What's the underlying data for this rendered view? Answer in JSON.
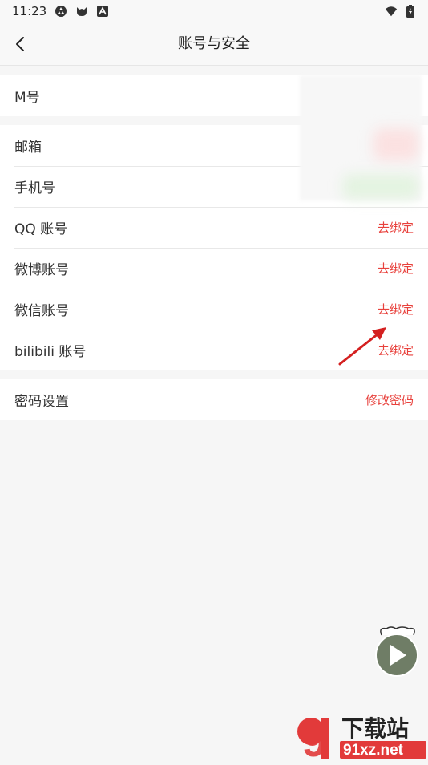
{
  "status_bar": {
    "time": "11:23"
  },
  "header": {
    "title": "账号与安全"
  },
  "groups": [
    {
      "rows": [
        {
          "label": "M号"
        }
      ]
    },
    {
      "rows": [
        {
          "label": "邮箱"
        },
        {
          "label": "手机号"
        },
        {
          "label": "QQ 账号",
          "action": "去绑定"
        },
        {
          "label": "微博账号",
          "action": "去绑定"
        },
        {
          "label": "微信账号",
          "action": "去绑定"
        },
        {
          "label": "bilibili 账号",
          "action": "去绑定"
        }
      ]
    },
    {
      "rows": [
        {
          "label": "密码设置",
          "action": "修改密码"
        }
      ]
    }
  ],
  "watermark": {
    "brand": "9",
    "text": "下载站",
    "domain": "91xz.net"
  },
  "colors": {
    "accent": "#e8413c",
    "background": "#f6f6f6"
  }
}
